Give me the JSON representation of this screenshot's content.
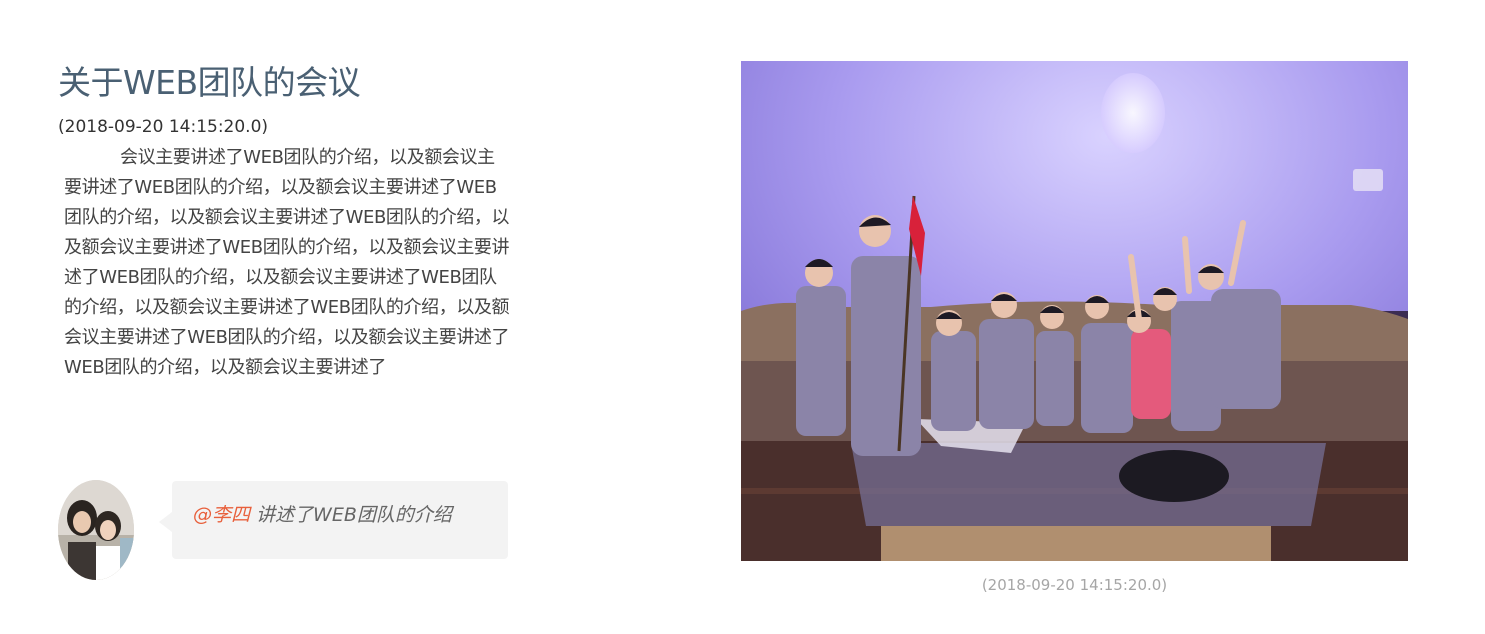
{
  "article": {
    "title": "关于WEB团队的会议",
    "date": "(2018-09-20 14:15:20.0)",
    "body": "会议主要讲述了WEB团队的介绍，以及额会议主要讲述了WEB团队的介绍，以及额会议主要讲述了WEB团队的介绍，以及额会议主要讲述了WEB团队的介绍，以及额会议主要讲述了WEB团队的介绍，以及额会议主要讲述了WEB团队的介绍，以及额会议主要讲述了WEB团队的介绍，以及额会议主要讲述了WEB团队的介绍，以及额会议主要讲述了WEB团队的介绍，以及额会议主要讲述了WEB团队的介绍，以及额会议主要讲述了"
  },
  "comment": {
    "mention": "@李四",
    "text": " 讲述了WEB团队的介绍"
  },
  "photo": {
    "caption": "(2018-09-20 14:15:20.0)"
  }
}
